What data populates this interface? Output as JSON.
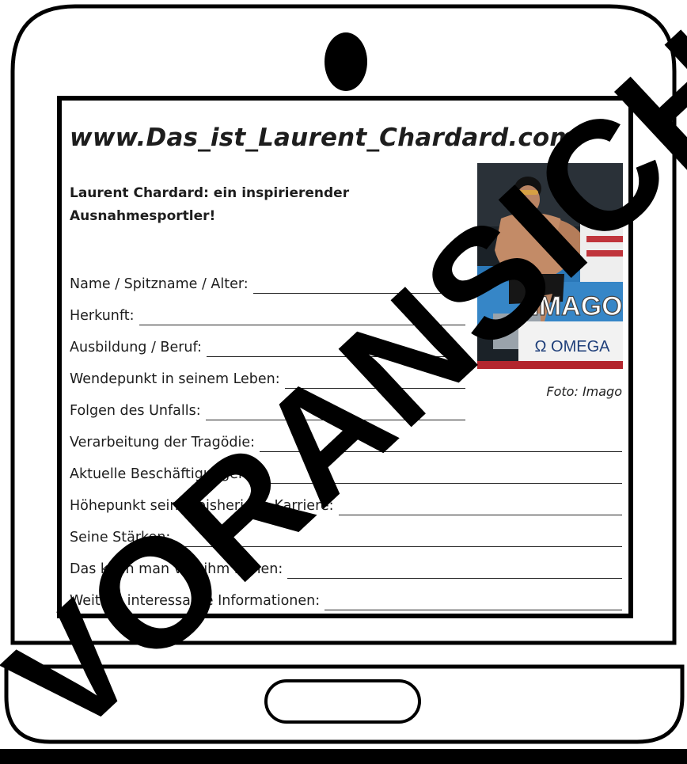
{
  "website_title": "www.Das_ist_Laurent_Chardard.com",
  "headline": "Laurent Chardard: ein inspirierender Ausnahmesportler!",
  "photo": {
    "credit": "Foto: Imago",
    "watermark": "IMAGO",
    "sponsor": "Ω OMEGA"
  },
  "fields": [
    {
      "label": "Name / Spitzname / Alter:"
    },
    {
      "label": "Herkunft:"
    },
    {
      "label": "Ausbildung / Beruf:"
    },
    {
      "label": "Wendepunkt in seinem Leben:"
    },
    {
      "label": "Folgen des Unfalls:"
    },
    {
      "label": "Verarbeitung der Tragödie:"
    },
    {
      "label": "Aktuelle Beschäftigungen:"
    },
    {
      "label": "Höhepunkt seiner bisherigen Karriere:"
    },
    {
      "label": "Seine Stärken:"
    },
    {
      "label": "Das kann man von ihm lernen:"
    },
    {
      "label": "Weitere interessante Informationen:"
    }
  ],
  "overlay_watermark": "VORANSICHT"
}
